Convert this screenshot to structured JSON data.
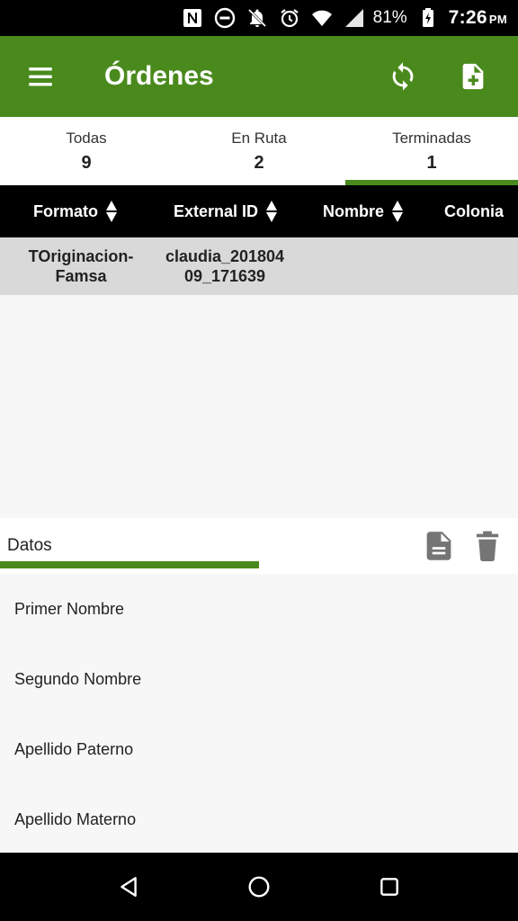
{
  "status_bar": {
    "battery": "81%",
    "time": "7:26",
    "ampm": "PM",
    "icons": [
      "nfc-icon",
      "do-not-disturb-icon",
      "notifications-off-icon",
      "alarm-icon",
      "wifi-icon",
      "signal-icon",
      "battery-charging-icon"
    ]
  },
  "app_bar": {
    "title": "Órdenes",
    "color": "#4a8a1d"
  },
  "tabs": [
    {
      "label": "Todas",
      "count": "9",
      "selected": false
    },
    {
      "label": "En Ruta",
      "count": "2",
      "selected": false
    },
    {
      "label": "Terminadas",
      "count": "1",
      "selected": true
    }
  ],
  "table": {
    "columns": [
      "Formato",
      "External ID",
      "Nombre",
      "Colonia"
    ],
    "rows": [
      {
        "formato_line1": "TOriginacion-",
        "formato_line2": "Famsa",
        "external_line1": "claudia_201804",
        "external_line2": "09_171639"
      }
    ]
  },
  "detail": {
    "title": "Datos",
    "fields": [
      "Primer Nombre",
      "Segundo Nombre",
      "Apellido Paterno",
      "Apellido Materno"
    ]
  }
}
